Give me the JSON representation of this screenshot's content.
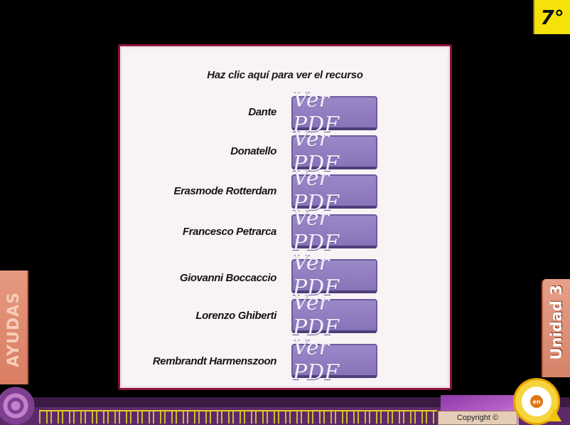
{
  "grade": "7°",
  "panel": {
    "title": "Haz clic aquí para ver el recurso",
    "button_label": "Ver PDF",
    "resources": [
      {
        "name": "Dante"
      },
      {
        "name": "Donatello"
      },
      {
        "name": "Erasmode Rotterdam"
      },
      {
        "name": "Francesco Petrarca"
      },
      {
        "name": "Giovanni Boccaccio"
      },
      {
        "name": "Lorenzo Ghiberti"
      },
      {
        "name": "Rembrandt Harmenszoon"
      }
    ]
  },
  "side_tab": "Unidad 3",
  "left_deco_text": "AYUDAS",
  "footer": {
    "copyright": "Copyright ©"
  },
  "logo": {
    "core_text": "en"
  },
  "icons": [
    "spiral-icon",
    "warning-icon",
    "logo-icon"
  ],
  "colors": {
    "panel_border": "#8a1238",
    "button": "#8873b8",
    "grade_badge": "#f5e20a"
  }
}
